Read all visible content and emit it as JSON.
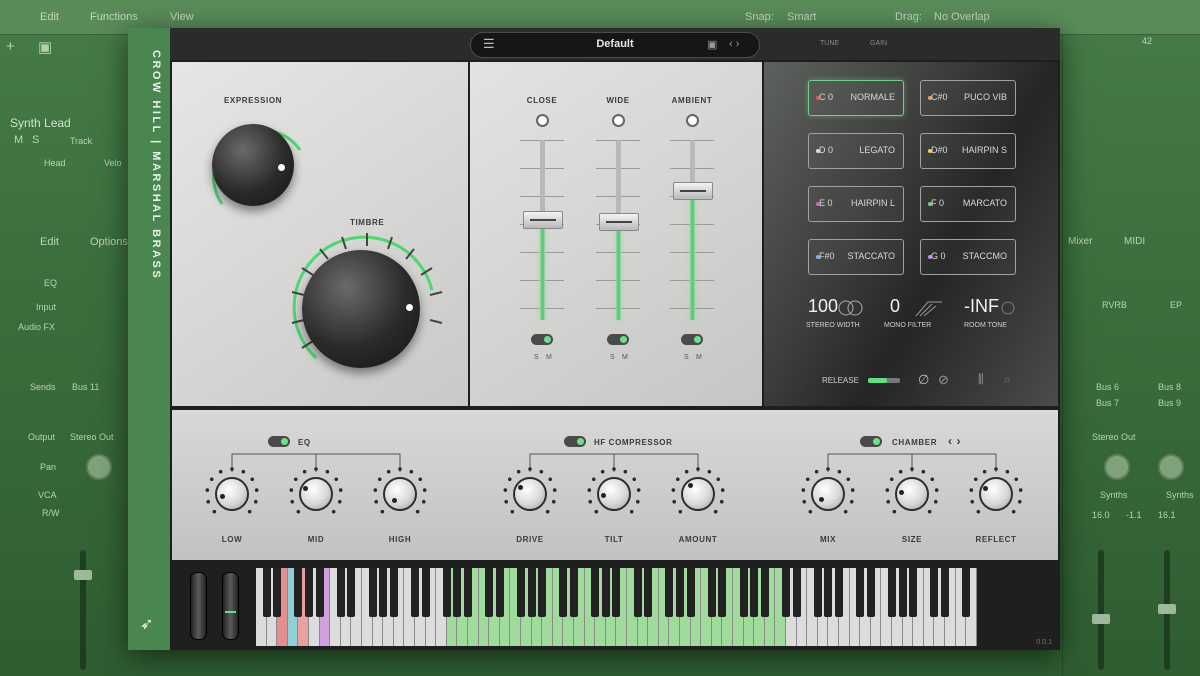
{
  "daw": {
    "menu": {
      "edit": "Edit",
      "functions": "Functions",
      "view": "View"
    },
    "top_right": {
      "snap_label": "Snap:",
      "snap_value": "Smart",
      "drag_label": "Drag:",
      "drag_value": "No Overlap"
    },
    "track": {
      "name": "Synth Lead",
      "m": "M",
      "s": "S",
      "track_btn": "Track",
      "head": "Head",
      "vel": "Velo"
    },
    "inspector": {
      "edit": "Edit",
      "options": "Options",
      "eq": "EQ",
      "input": "Input",
      "audio_fx": "Audio FX",
      "sends": "Sends",
      "output": "Output",
      "pan": "Pan",
      "vca": "VCA",
      "rw": "R/W",
      "bus": "Bus 11",
      "stereo_out": "Stereo Out"
    },
    "right_strips": {
      "mixer": "Mixer",
      "midi": "MIDI",
      "rvrb": "RVRB",
      "ep": "EP",
      "bus6": "Bus 6",
      "bus8": "Bus 8",
      "bus7": "Bus 7",
      "bus9": "Bus 9",
      "stereo_out": "Stereo Out",
      "synths": "Synths",
      "val1": "16.0",
      "val2": "16.1",
      "val3": "-1.1",
      "ruler": "42"
    }
  },
  "plugin": {
    "title": "CROW HILL | MARSHAL BRASS",
    "preset": "Default",
    "tune_label": "TUNE",
    "gain_label": "GAIN",
    "expression_label": "EXPRESSION",
    "timbre_label": "TIMBRE",
    "mics": [
      {
        "label": "CLOSE",
        "s": "S",
        "m": "M",
        "level": 0.56
      },
      {
        "label": "WIDE",
        "s": "S",
        "m": "M",
        "level": 0.55
      },
      {
        "label": "AMBIENT",
        "s": "S",
        "m": "M",
        "level": 0.72
      }
    ],
    "articulations": [
      {
        "note": "C 0",
        "name": "NORMALE",
        "color": "#e05a5a",
        "selected": true
      },
      {
        "note": "C#0",
        "name": "PUCO VIB",
        "color": "#e8a35a",
        "selected": false
      },
      {
        "note": "D 0",
        "name": "LEGATO",
        "color": "#e0e0e0",
        "selected": false
      },
      {
        "note": "D#0",
        "name": "HAIRPIN S",
        "color": "#e8d35a",
        "selected": false
      },
      {
        "note": "E 0",
        "name": "HAIRPIN L",
        "color": "#e05ac0",
        "selected": false
      },
      {
        "note": "F 0",
        "name": "MARCATO",
        "color": "#6fd08a",
        "selected": false
      },
      {
        "note": "F#0",
        "name": "STACCATO",
        "color": "#8ab0ff",
        "selected": false
      },
      {
        "note": "G 0",
        "name": "STACCMO",
        "color": "#c08aff",
        "selected": false
      }
    ],
    "stereo_width": {
      "value": "100",
      "label": "STEREO WIDTH"
    },
    "mono_filter": {
      "value": "0",
      "label": "MONO FILTER"
    },
    "room_tone": {
      "value": "-INF",
      "label": "ROOM TONE"
    },
    "release_label": "RELEASE",
    "release_level": 0.6,
    "eq": {
      "label": "EQ",
      "knobs": [
        "LOW",
        "MID",
        "HIGH"
      ]
    },
    "compressor": {
      "label": "HF COMPRESSOR",
      "knobs": [
        "DRIVE",
        "TILT",
        "AMOUNT"
      ]
    },
    "chamber": {
      "label": "CHAMBER",
      "knobs": [
        "MIX",
        "SIZE",
        "REFLECT"
      ]
    },
    "version": "0.0.1"
  },
  "icons": {
    "plus": "plus-icon",
    "browser": "browser-icon",
    "menu": "hamburger-icon",
    "save": "save-icon",
    "arrows": "nav-arrows-icon",
    "bird": "bird-logo-icon"
  }
}
